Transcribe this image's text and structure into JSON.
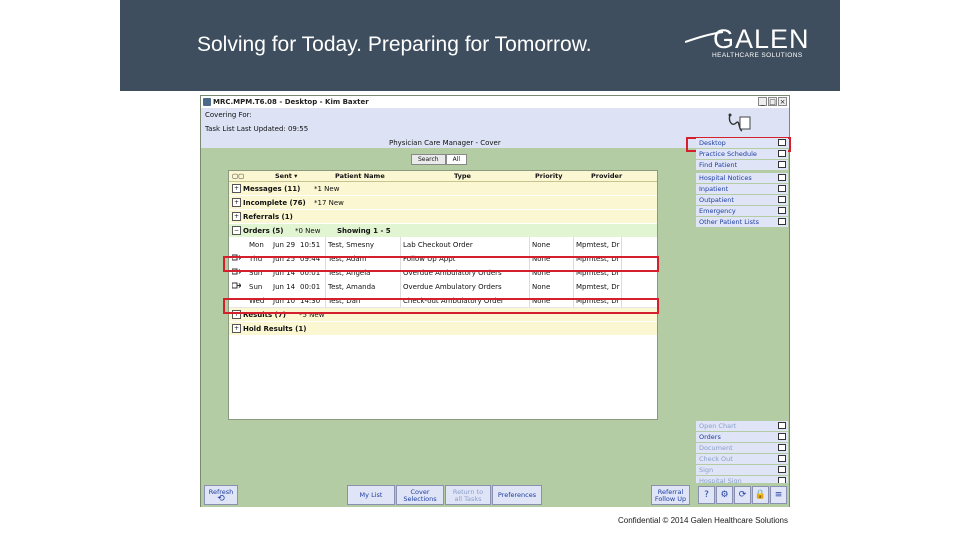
{
  "banner": {
    "tagline": "Solving for Today. Preparing for Tomorrow.",
    "logo_word": "GALEN",
    "logo_sub": "HEALTHCARE SOLUTIONS",
    "bg_color": "#3f4e5e"
  },
  "window": {
    "title": "MRC.MPM.T6.08 - Desktop - Kim Baxter",
    "controls": [
      "_",
      "□",
      "×"
    ]
  },
  "header": {
    "covering_for": "Covering For:",
    "task_list_updated": "Task List Last Updated: 09:55",
    "manager_title": "Physician Care Manager - Cover"
  },
  "filter_toggle": {
    "options": [
      "Search",
      "All"
    ],
    "selected": "All"
  },
  "grid": {
    "columns": [
      "Sent ▾",
      "Patient Name",
      "Type",
      "Priority",
      "Provider"
    ],
    "groups": [
      {
        "label": "Messages (11)",
        "new": "*1 New",
        "showing": ""
      },
      {
        "label": "Incomplete (76)",
        "new": "*17 New",
        "showing": ""
      },
      {
        "label": "Referrals (1)",
        "new": "",
        "showing": ""
      },
      {
        "label": "Orders (5)",
        "new": "*0 New",
        "showing": "Showing 1 - 5"
      },
      {
        "label": "Results (7)",
        "new": "*5 New",
        "showing": ""
      },
      {
        "label": "Hold Results (1)",
        "new": "",
        "showing": ""
      }
    ],
    "orders": [
      {
        "day": "Mon",
        "date": "Jun 29",
        "time": "10:51",
        "patient": "Test, Smesny",
        "type": "Lab Checkout Order",
        "priority": "None",
        "provider": "Mpmtest, Dr"
      },
      {
        "day": "Thu",
        "date": "Jun 25",
        "time": "09:44",
        "patient": "Test, Adam",
        "type": "Follow Up Appt",
        "priority": "None",
        "provider": "Mpmtest, Dr"
      },
      {
        "day": "Sun",
        "date": "Jun 14",
        "time": "00:01",
        "patient": "Test, Angela",
        "type": "Overdue Ambulatory Orders",
        "priority": "None",
        "provider": "Mpmtest, Dr"
      },
      {
        "day": "Sun",
        "date": "Jun 14",
        "time": "00:01",
        "patient": "Test, Amanda",
        "type": "Overdue Ambulatory Orders",
        "priority": "None",
        "provider": "Mpmtest, Dr"
      },
      {
        "day": "Wed",
        "date": "Jun 10",
        "time": "14:30",
        "patient": "Test, Dan",
        "type": "Check-out Ambulatory Order",
        "priority": "None",
        "provider": "Mpmtest, Dr"
      }
    ]
  },
  "right_panel": {
    "top_items": [
      "Desktop",
      "Practice Schedule",
      "Find Patient"
    ],
    "mid_items": [
      "Hospital Notices",
      "Inpatient",
      "Outpatient",
      "Emergency",
      "Other Patient Lists"
    ],
    "bottom_items": [
      "Open Chart",
      "Orders",
      "Document",
      "Check Out",
      "Sign",
      "Hospital Sign"
    ]
  },
  "bottom_bar": {
    "refresh": "Refresh",
    "my_list": "My List",
    "cover_selections_1": "Cover",
    "cover_selections_2": "Selections",
    "return_1": "Return to",
    "return_2": "all Tasks",
    "preferences": "Preferences",
    "referral_1": "Referral",
    "referral_2": "Follow Up",
    "help": "?"
  },
  "footer": "Confidential © 2014 Galen Healthcare Solutions",
  "colors": {
    "highlight": "#d41f2c",
    "window_bg": "#b4cca3",
    "link_blue": "#1e3ea0"
  }
}
